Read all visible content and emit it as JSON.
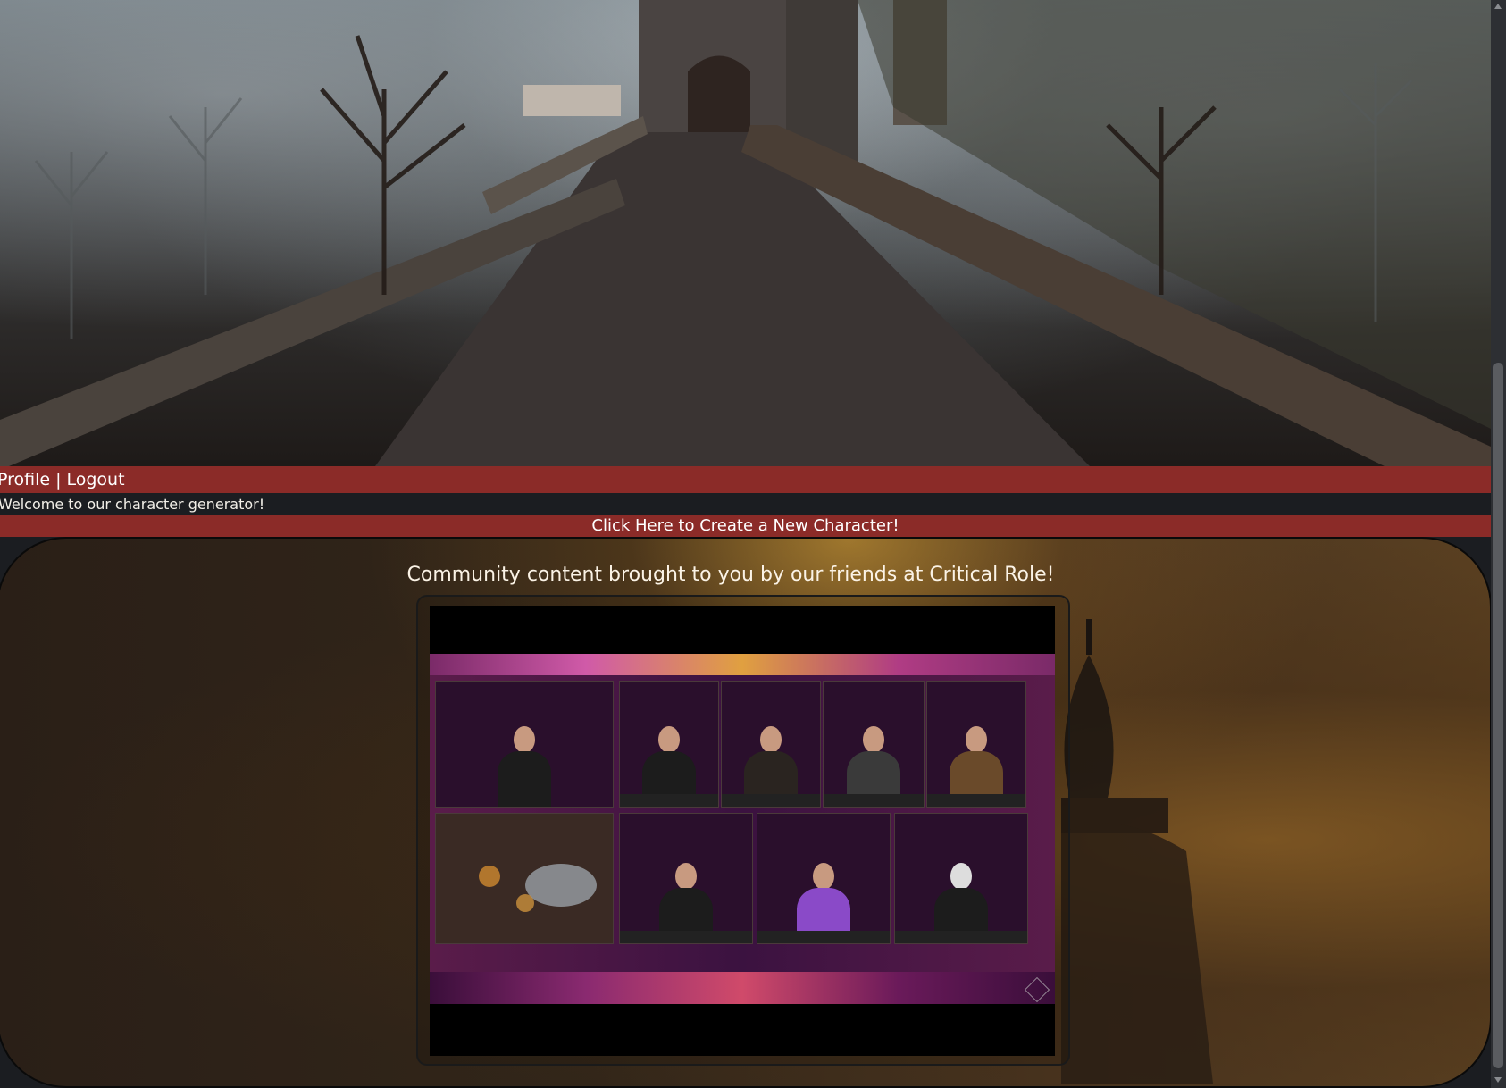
{
  "nav": {
    "profile_label": "Profile",
    "separator": "|",
    "logout_label": "Logout"
  },
  "welcome_text": "Welcome to our character generator!",
  "cta_label": "Click Here to Create a New Character!",
  "community": {
    "title": "Community content brought to you by our friends at Critical Role!"
  },
  "colors": {
    "accent_red": "#8b2b28",
    "dark_bg": "#1b1d21"
  }
}
